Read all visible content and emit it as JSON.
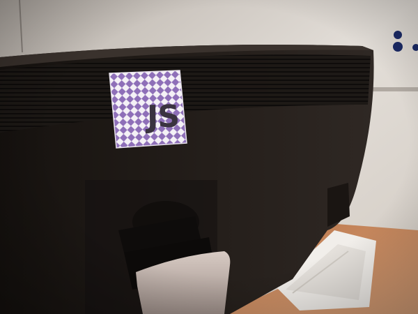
{
  "sticker": {
    "text": "JS",
    "pattern_color": "#8e6fb8",
    "background_color": "#f4f1f6",
    "text_color": "#3a3340"
  },
  "scene": {
    "monitor_color": "#1f1b19",
    "wall_color": "#d9d3cc",
    "desk_color": "#c9895a",
    "stand_color": "#b8a8a0",
    "magnet_color": "#1b2a66"
  }
}
